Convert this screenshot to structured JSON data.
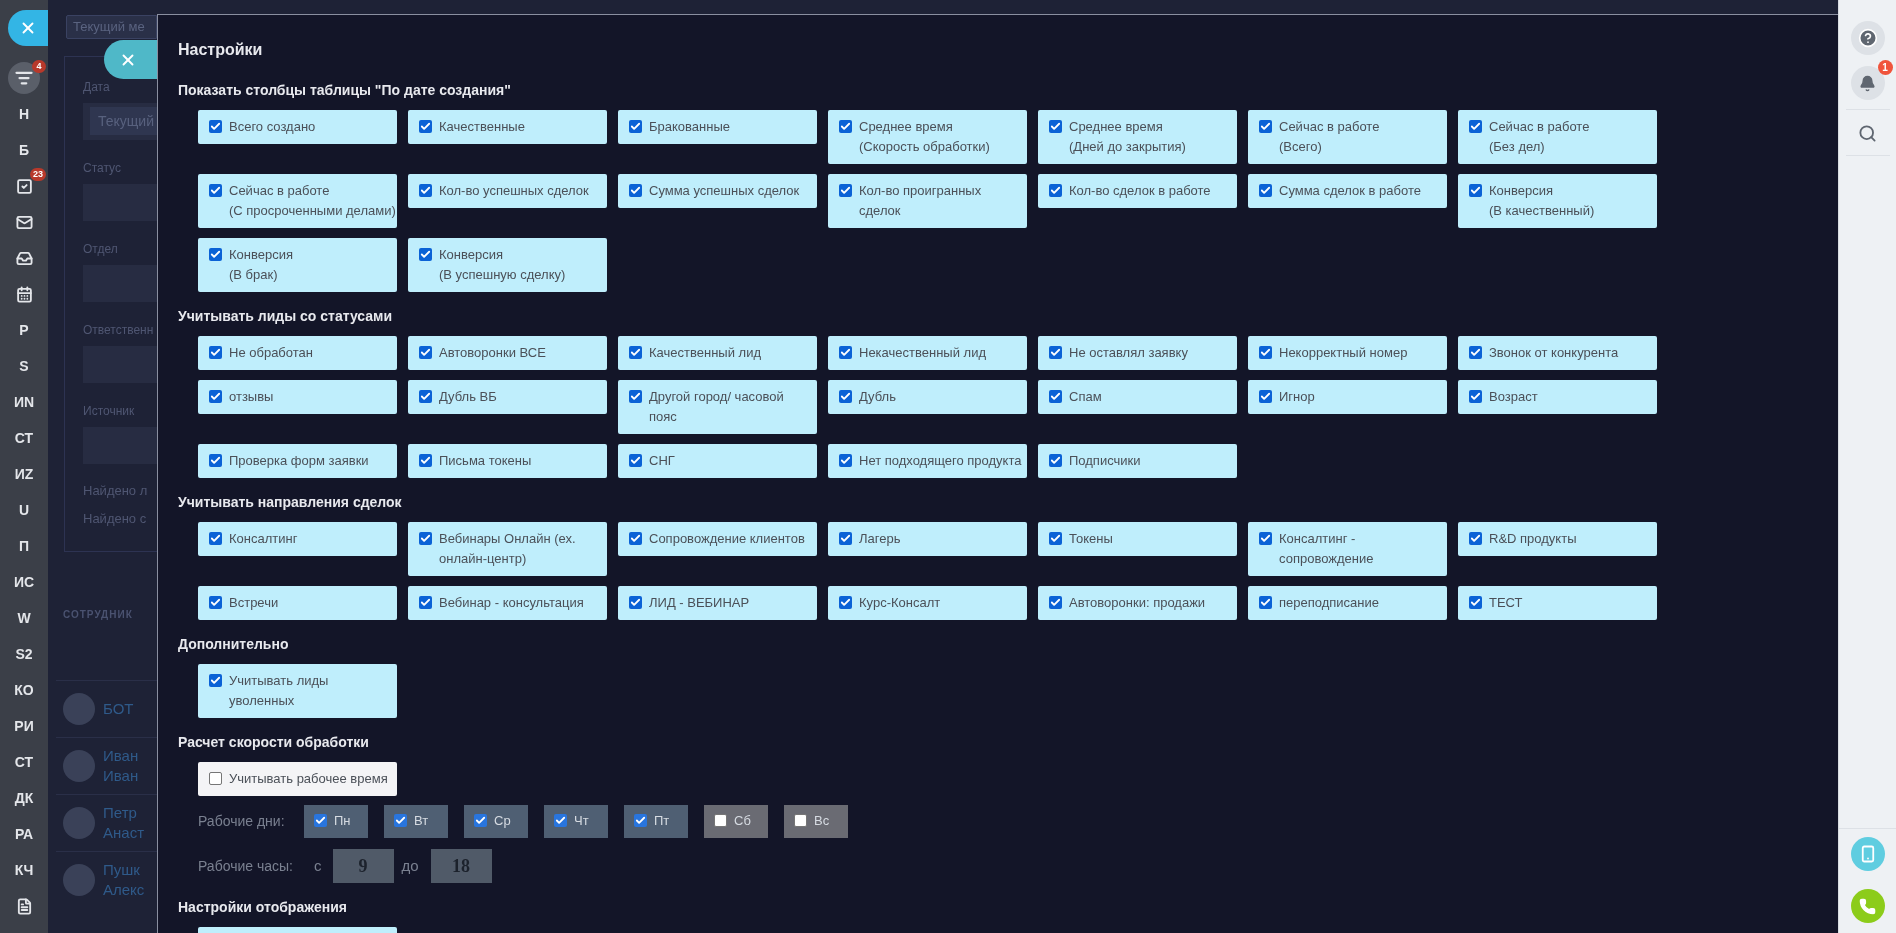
{
  "left_nav": [
    {
      "kind": "filter",
      "badge": "4"
    },
    {
      "kind": "text",
      "label": "Н"
    },
    {
      "kind": "text",
      "label": "Б"
    },
    {
      "kind": "tasks",
      "badge": "23"
    },
    {
      "kind": "mail"
    },
    {
      "kind": "inbox"
    },
    {
      "kind": "calendar"
    },
    {
      "kind": "text",
      "label": "Р"
    },
    {
      "kind": "text",
      "label": "S"
    },
    {
      "kind": "text",
      "label": "ИN"
    },
    {
      "kind": "text",
      "label": "СТ"
    },
    {
      "kind": "text",
      "label": "ИZ"
    },
    {
      "kind": "text",
      "label": "U"
    },
    {
      "kind": "text",
      "label": "П"
    },
    {
      "kind": "text",
      "label": "ИС"
    },
    {
      "kind": "text",
      "label": "W"
    },
    {
      "kind": "text",
      "label": "S2"
    },
    {
      "kind": "text",
      "label": "КО"
    },
    {
      "kind": "text",
      "label": "РИ"
    },
    {
      "kind": "text",
      "label": "СТ"
    },
    {
      "kind": "text",
      "label": "ДК"
    },
    {
      "kind": "text",
      "label": "РА"
    },
    {
      "kind": "text",
      "label": "КЧ"
    },
    {
      "kind": "document"
    }
  ],
  "background": {
    "top_field": "Текущий ме",
    "filters": [
      {
        "label": "Дата",
        "value": "Текущий"
      },
      {
        "label": "Статус"
      },
      {
        "label": "Отдел"
      },
      {
        "label": "Ответственн"
      },
      {
        "label": "Источник"
      }
    ],
    "found": [
      "Найдено л",
      "Найдено с"
    ],
    "column": "СОТРУДНИК",
    "employees": [
      {
        "lines": [
          "БОТ"
        ]
      },
      {
        "lines": [
          "Иван",
          "Иван"
        ]
      },
      {
        "lines": [
          "Петр",
          "Анаст"
        ]
      },
      {
        "lines": [
          "Пушк",
          "Алекс"
        ]
      }
    ]
  },
  "dialog": {
    "title": "Настройки",
    "sections": [
      {
        "kind": "checkboxes",
        "heading": "Показать столбцы таблицы \"По дате создания\"",
        "options": [
          {
            "lines": [
              "Всего создано"
            ],
            "checked": true
          },
          {
            "lines": [
              "Качественные"
            ],
            "checked": true
          },
          {
            "lines": [
              "Бракованные"
            ],
            "checked": true
          },
          {
            "lines": [
              "Среднее время",
              "(Скорость обработки)"
            ],
            "checked": true
          },
          {
            "lines": [
              "Среднее время",
              "(Дней до закрытия)"
            ],
            "checked": true
          },
          {
            "lines": [
              "Сейчас в работе",
              "(Всего)"
            ],
            "checked": true
          },
          {
            "lines": [
              "Сейчас в работе",
              "(Без дел)"
            ],
            "checked": true
          },
          {
            "lines": [
              "Сейчас в работе",
              "(С просроченными делами)"
            ],
            "checked": true
          },
          {
            "lines": [
              "Кол-во успешных сделок"
            ],
            "checked": true
          },
          {
            "lines": [
              "Сумма успешных сделок"
            ],
            "checked": true
          },
          {
            "lines": [
              "Кол-во проигранных",
              "сделок"
            ],
            "checked": true
          },
          {
            "lines": [
              "Кол-во сделок в работе"
            ],
            "checked": true
          },
          {
            "lines": [
              "Сумма сделок в работе"
            ],
            "checked": true
          },
          {
            "lines": [
              "Конверсия",
              "(В качественный)"
            ],
            "checked": true
          },
          {
            "lines": [
              "Конверсия",
              "(В брак)"
            ],
            "checked": true
          },
          {
            "lines": [
              "Конверсия",
              "(В успешную сделку)"
            ],
            "checked": true
          }
        ]
      },
      {
        "kind": "checkboxes",
        "heading": "Учитывать лиды со статусами",
        "options": [
          {
            "lines": [
              "Не обработан"
            ],
            "checked": true
          },
          {
            "lines": [
              "Автоворонки ВСЕ"
            ],
            "checked": true
          },
          {
            "lines": [
              "Качественный лид"
            ],
            "checked": true
          },
          {
            "lines": [
              "Некачественный лид"
            ],
            "checked": true
          },
          {
            "lines": [
              "Не оставлял заявку"
            ],
            "checked": true
          },
          {
            "lines": [
              "Некорректный номер"
            ],
            "checked": true
          },
          {
            "lines": [
              "Звонок от конкурента"
            ],
            "checked": true
          },
          {
            "lines": [
              "отзывы"
            ],
            "checked": true
          },
          {
            "lines": [
              "Дубль ВБ"
            ],
            "checked": true
          },
          {
            "lines": [
              "Другой город/ часовой",
              "пояс"
            ],
            "checked": true
          },
          {
            "lines": [
              "Дубль"
            ],
            "checked": true
          },
          {
            "lines": [
              "Спам"
            ],
            "checked": true
          },
          {
            "lines": [
              "Игнор"
            ],
            "checked": true
          },
          {
            "lines": [
              "Возраст"
            ],
            "checked": true
          },
          {
            "lines": [
              "Проверка форм заявки"
            ],
            "checked": true
          },
          {
            "lines": [
              "Письма токены"
            ],
            "checked": true
          },
          {
            "lines": [
              "СНГ"
            ],
            "checked": true
          },
          {
            "lines": [
              "Нет подходящего продукта"
            ],
            "checked": true
          },
          {
            "lines": [
              "Подписчики"
            ],
            "checked": true
          }
        ]
      },
      {
        "kind": "checkboxes",
        "heading": "Учитывать направления сделок",
        "options": [
          {
            "lines": [
              "Консалтинг"
            ],
            "checked": true
          },
          {
            "lines": [
              "Вебинары Онлайн (ех.",
              "онлайн-центр)"
            ],
            "checked": true
          },
          {
            "lines": [
              "Сопровождение клиентов"
            ],
            "checked": true
          },
          {
            "lines": [
              "Лагерь"
            ],
            "checked": true
          },
          {
            "lines": [
              "Токены"
            ],
            "checked": true
          },
          {
            "lines": [
              "Консалтинг -",
              "сопровождение"
            ],
            "checked": true
          },
          {
            "lines": [
              "R&D продукты"
            ],
            "checked": true
          },
          {
            "lines": [
              "Встречи"
            ],
            "checked": true
          },
          {
            "lines": [
              "Вебинар - консультация"
            ],
            "checked": true
          },
          {
            "lines": [
              "ЛИД - ВЕБИНАР"
            ],
            "checked": true
          },
          {
            "lines": [
              "Курс-Консалт"
            ],
            "checked": true
          },
          {
            "lines": [
              "Автоворонки: продажи"
            ],
            "checked": true
          },
          {
            "lines": [
              "переподписание"
            ],
            "checked": true
          },
          {
            "lines": [
              "ТЕСТ"
            ],
            "checked": true
          }
        ]
      },
      {
        "kind": "checkboxes",
        "heading": "Дополнительно",
        "options": [
          {
            "lines": [
              "Учитывать лиды",
              "уволенных"
            ],
            "checked": true
          }
        ]
      },
      {
        "kind": "work_time",
        "heading": "Расчет скорости обработки",
        "option": {
          "lines": [
            "Учитывать рабочее время"
          ],
          "checked": false
        },
        "disabled": true,
        "days_label": "Рабочие дни:",
        "days": [
          {
            "label": "Пн",
            "checked": true
          },
          {
            "label": "Вт",
            "checked": true
          },
          {
            "label": "Ср",
            "checked": true
          },
          {
            "label": "Чт",
            "checked": true
          },
          {
            "label": "Пт",
            "checked": true
          },
          {
            "label": "Сб",
            "checked": false
          },
          {
            "label": "Вс",
            "checked": false
          }
        ],
        "hours_label": "Рабочие часы:",
        "from_label": "с",
        "from": "9",
        "to_label": "до",
        "to": "18"
      },
      {
        "kind": "cut",
        "heading": "Настройки отображения"
      }
    ]
  },
  "right_bar": {
    "notifications_badge": "1"
  }
}
